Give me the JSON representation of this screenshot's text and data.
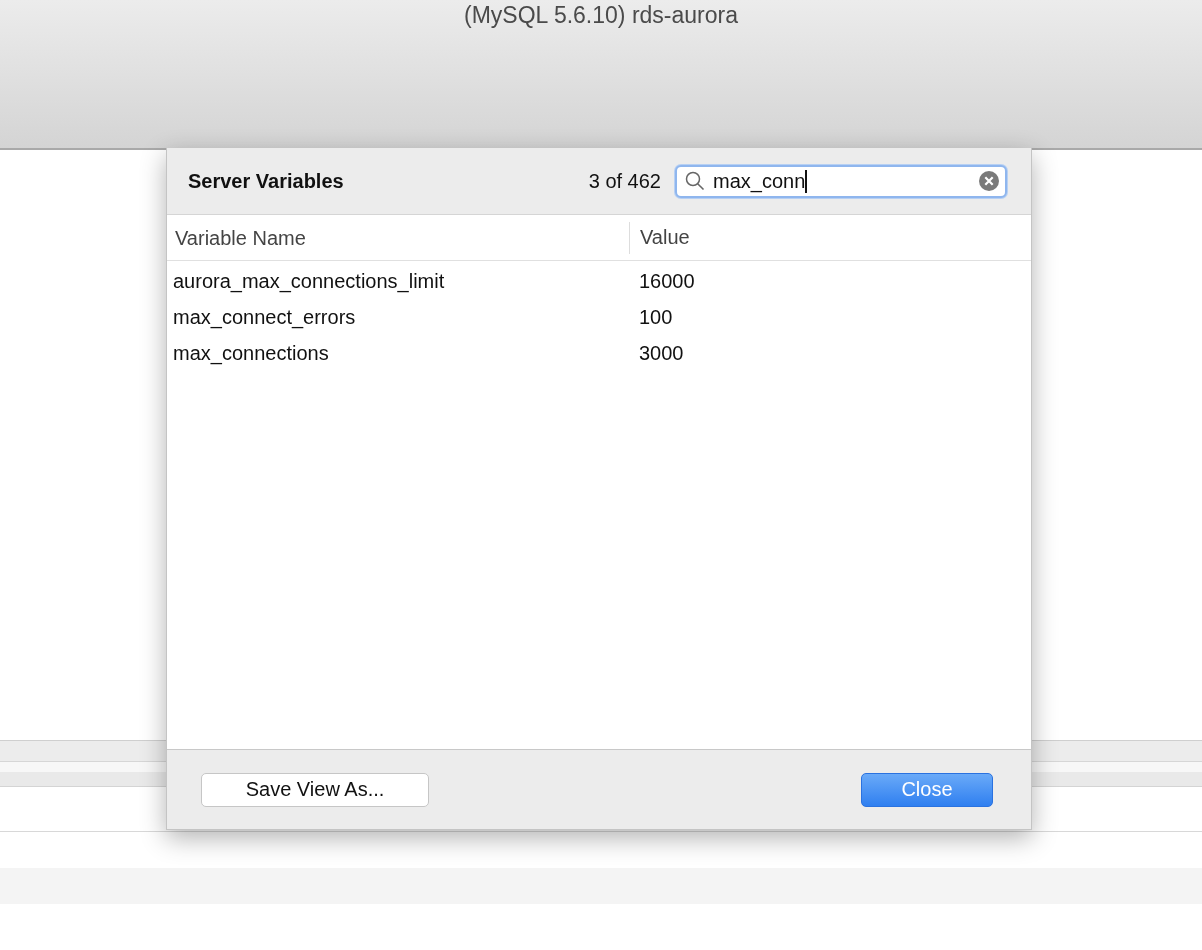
{
  "window": {
    "title": "(MySQL 5.6.10) rds-aurora"
  },
  "sheet": {
    "title": "Server Variables",
    "match_count": "3 of 462",
    "search": {
      "value": "max_conn"
    },
    "columns": [
      "Variable Name",
      "Value"
    ],
    "rows": [
      [
        "aurora_max_connections_limit",
        "16000"
      ],
      [
        "max_connect_errors",
        "100"
      ],
      [
        "max_connections",
        "3000"
      ]
    ],
    "buttons": [
      {
        "label": "Save View As...",
        "kind": "normal"
      },
      {
        "label": "Close",
        "kind": "default"
      }
    ]
  }
}
